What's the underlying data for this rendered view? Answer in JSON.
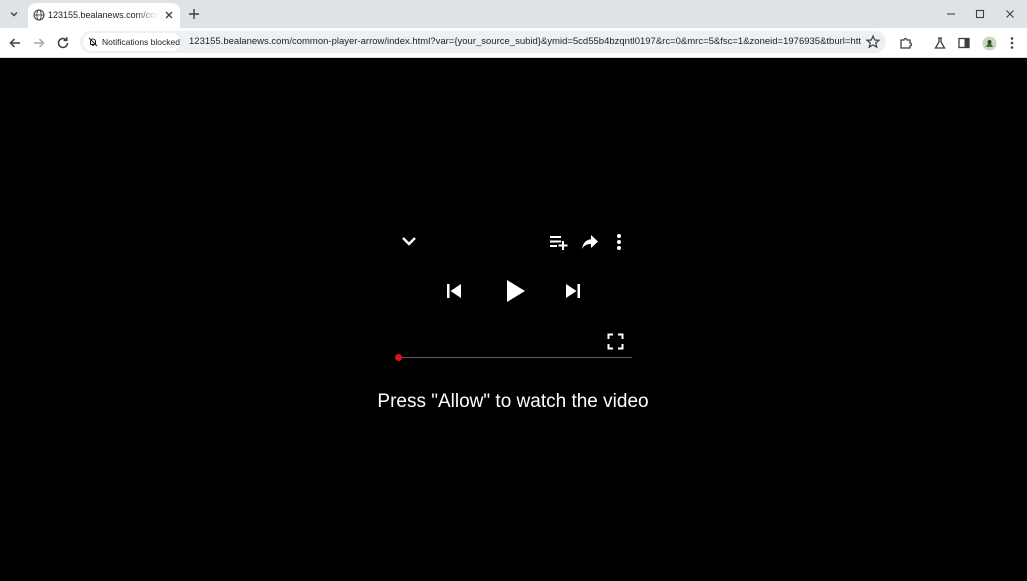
{
  "browser": {
    "tab": {
      "title": "123155.bealanews.com/common"
    },
    "toolbar": {
      "notification_chip": "Notifications blocked",
      "url": "123155.bealanews.com/common-player-arrow/index.html?var={your_source_subid}&ymid=5cd55b4bzqntl0197&rc=0&mrc=5&fsc=1&zoneid=1976935&tburl=htt..."
    }
  },
  "player": {
    "message": "Press \"Allow\" to watch the video",
    "progress": 0,
    "icons": [
      "collapse-icon",
      "add-to-queue-icon",
      "share-icon",
      "more-vertical-icon",
      "previous-icon",
      "play-icon",
      "next-icon",
      "fullscreen-icon"
    ]
  },
  "colors": {
    "page_background": "#000000",
    "progress_knob": "#e3101a",
    "chrome_frame": "#dfe3e8",
    "omnibox": "#eef1f4"
  }
}
